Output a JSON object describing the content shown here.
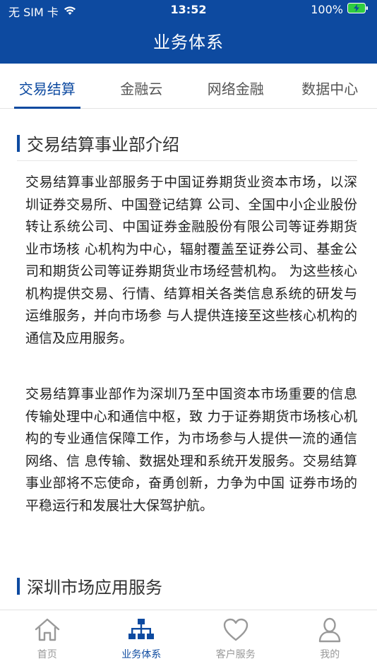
{
  "status_bar": {
    "carrier": "无 SIM 卡",
    "time": "13:52",
    "battery": "100%"
  },
  "nav": {
    "title": "业务体系"
  },
  "tabs": [
    {
      "label": "交易结算"
    },
    {
      "label": "金融云"
    },
    {
      "label": "网络金融"
    },
    {
      "label": "数据中心"
    }
  ],
  "content": {
    "section1_title": "交易结算事业部介绍",
    "para1": "交易结算事业部服务于中国证券期货业资本市场，以深圳证券交易所、中国登记结算 公司、全国中小企业股份转让系统公司、中国证券金融股份有限公司等证券期货业市场核 心机构为中心，辐射覆盖至证券公司、基金公司和期货公司等证券期货业市场经营机构。 为这些核心机构提供交易、行情、结算相关各类信息系统的研发与运维服务，并向市场参 与人提供连接至这些核心机构的通信及应用服务。",
    "para2": "交易结算事业部作为深圳乃至中国资本市场重要的信息传输处理中心和通信中枢，致 力于证券期货市场核心机构的专业通信保障工作，为市场参与人提供一流的通信网络、信 息传输、数据处理和系统开发服务。交易结算事业部将不忘使命，奋勇创新，力争为中国 证券市场的平稳运行和发展壮大保驾护航。",
    "section2_title": "深圳市场应用服务"
  },
  "bottom_tabs": [
    {
      "label": "首页",
      "icon": "home-icon"
    },
    {
      "label": "业务体系",
      "icon": "org-chart-icon"
    },
    {
      "label": "客户服务",
      "icon": "heart-icon"
    },
    {
      "label": "我的",
      "icon": "user-icon"
    }
  ],
  "colors": {
    "brand": "#0d4aa0",
    "battery": "#2ecc40"
  }
}
